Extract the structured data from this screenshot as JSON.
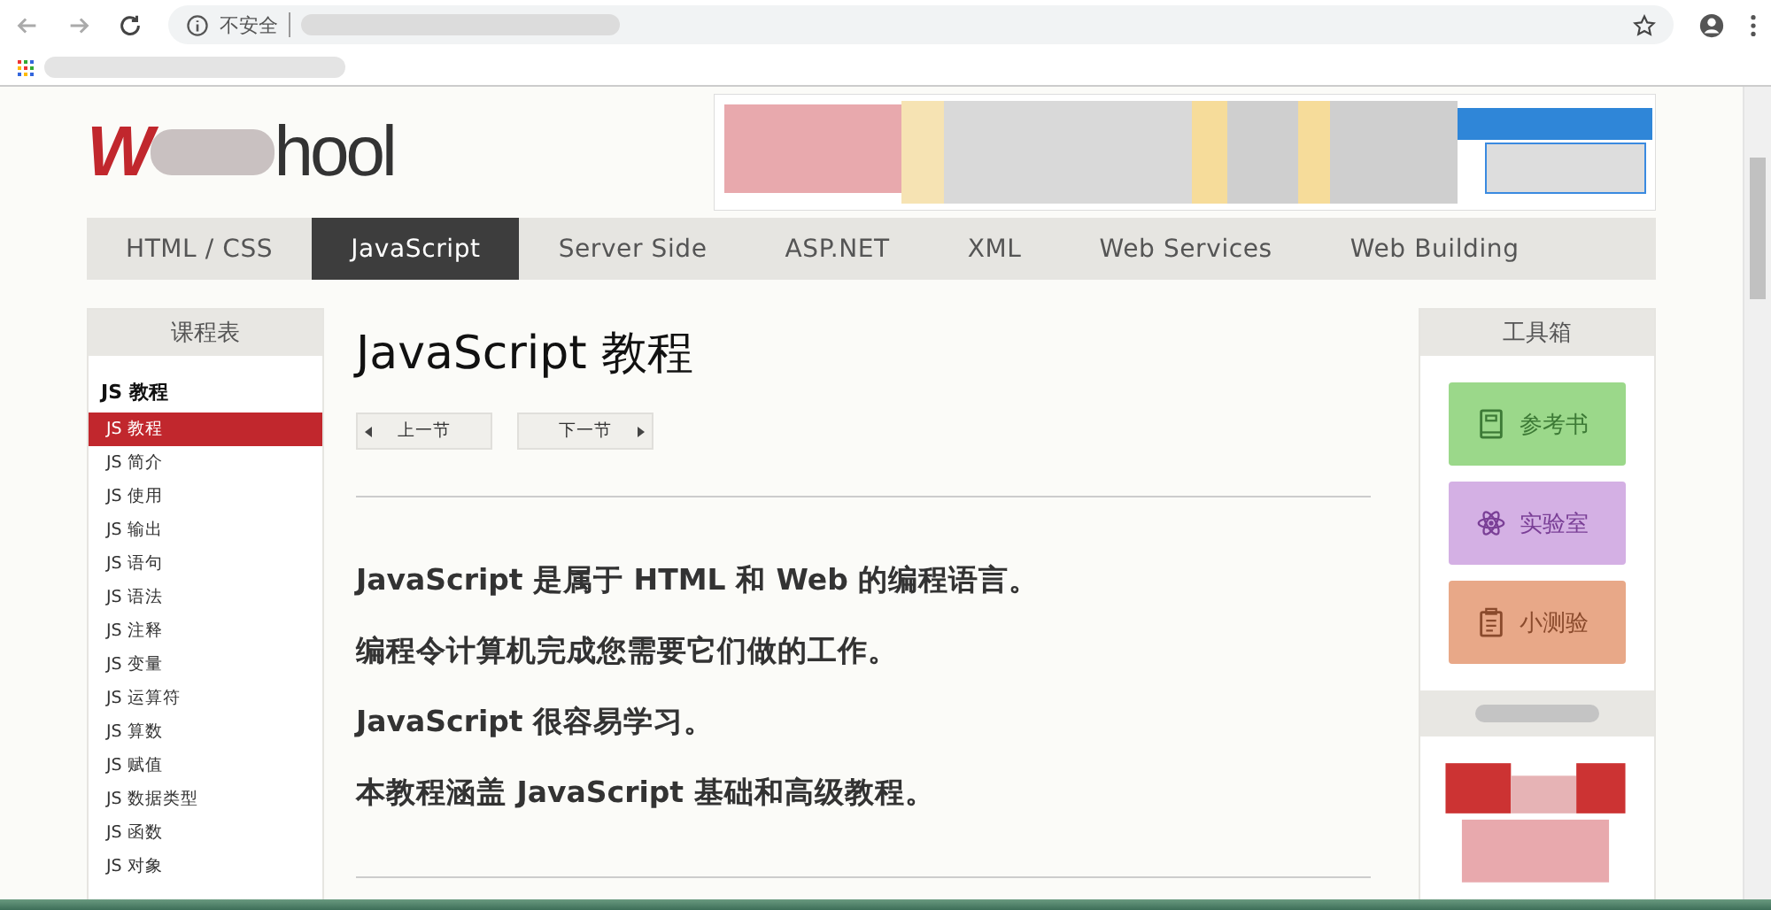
{
  "browser": {
    "security_label": "不安全"
  },
  "logo": {
    "first": "W",
    "last": "hool"
  },
  "nav_tabs": [
    {
      "label": "HTML / CSS",
      "selected": false
    },
    {
      "label": "JavaScript",
      "selected": true
    },
    {
      "label": "Server Side",
      "selected": false
    },
    {
      "label": "ASP.NET",
      "selected": false
    },
    {
      "label": "XML",
      "selected": false
    },
    {
      "label": "Web Services",
      "selected": false
    },
    {
      "label": "Web Building",
      "selected": false
    }
  ],
  "sidebar": {
    "title": "课程表",
    "section": "JS 教程",
    "items": [
      {
        "label": "JS 教程",
        "selected": true
      },
      {
        "label": "JS 简介",
        "selected": false
      },
      {
        "label": "JS 使用",
        "selected": false
      },
      {
        "label": "JS 输出",
        "selected": false
      },
      {
        "label": "JS 语句",
        "selected": false
      },
      {
        "label": "JS 语法",
        "selected": false
      },
      {
        "label": "JS 注释",
        "selected": false
      },
      {
        "label": "JS 变量",
        "selected": false
      },
      {
        "label": "JS 运算符",
        "selected": false
      },
      {
        "label": "JS 算数",
        "selected": false
      },
      {
        "label": "JS 赋值",
        "selected": false
      },
      {
        "label": "JS 数据类型",
        "selected": false
      },
      {
        "label": "JS 函数",
        "selected": false
      },
      {
        "label": "JS 对象",
        "selected": false
      }
    ]
  },
  "main": {
    "title": "JavaScript 教程",
    "prev": "上一节",
    "next": "下一节",
    "paragraphs": [
      "JavaScript 是属于 HTML 和 Web 的编程语言。",
      "编程令计算机完成您需要它们做的工作。",
      "JavaScript 很容易学习。",
      "本教程涵盖 JavaScript 基础和高级教程。"
    ]
  },
  "toolbox": {
    "title": "工具箱",
    "buttons": [
      {
        "label": "参考书",
        "kind": "book",
        "color": "#9bd88a"
      },
      {
        "label": "实验室",
        "kind": "atom",
        "color": "#d4b0e4"
      },
      {
        "label": "小测验",
        "kind": "quiz",
        "color": "#e8a888"
      }
    ]
  }
}
